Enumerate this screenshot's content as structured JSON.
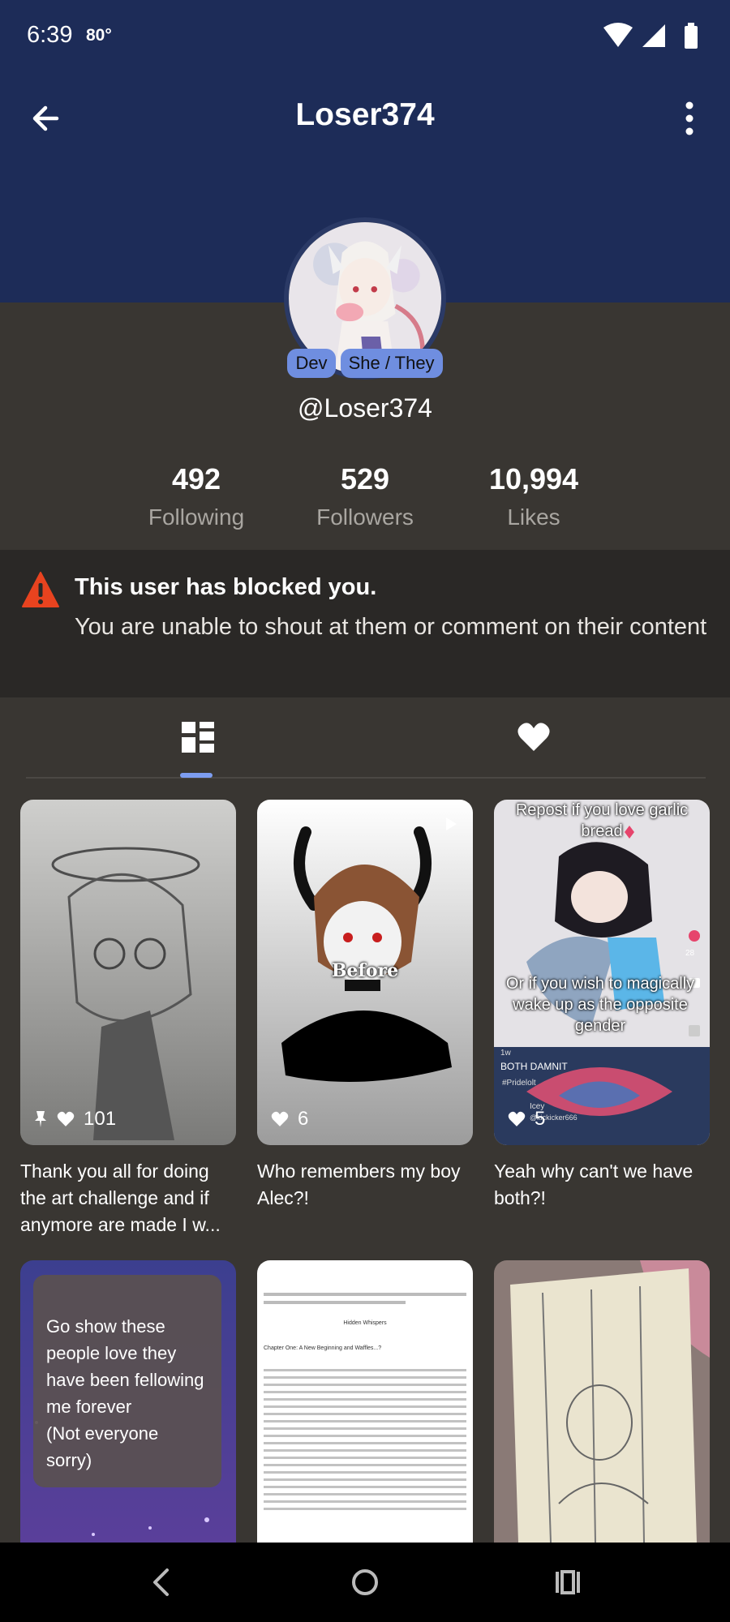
{
  "status": {
    "time": "6:39",
    "temperature": "80°"
  },
  "header": {
    "title": "Loser374"
  },
  "profile": {
    "badges": [
      "Dev",
      "She / They"
    ],
    "handle": "@Loser374",
    "stats": [
      {
        "value": "492",
        "label": "Following"
      },
      {
        "value": "529",
        "label": "Followers"
      },
      {
        "value": "10,994",
        "label": "Likes"
      }
    ]
  },
  "blocked": {
    "title": "This user has blocked you.",
    "text": "You are unable to shout at them or comment on their content"
  },
  "tabs": [
    "grid-icon",
    "heart-icon"
  ],
  "posts": [
    {
      "likes": "101",
      "pinned": true,
      "caption": "Thank you all for doing the art challenge and if anymore are made I w..."
    },
    {
      "likes": "6",
      "caption": "Who remembers my boy Alec?!",
      "overlay_text": "Before"
    },
    {
      "likes": "5",
      "caption": "Yeah why can't we have both?!",
      "overlay_top": "Repost if you love garlic bread",
      "overlay_bottom": "Or if you wish to magically wake up as the opposite gender",
      "side_count": "28",
      "inner_title": "BOTH DAMNIT",
      "inner_tag": "#Pridelolt",
      "inner_user": "Icey",
      "inner_handle": "@kickicker666",
      "inner_time": "1w"
    },
    {
      "text": "Go show these people love they have been fellowing me forever\n(Not everyone sorry)"
    },
    {
      "doc_title": "Hidden Whispers",
      "doc_chapter": "Chapter One: A New Beginning and Waffles...?"
    },
    {}
  ],
  "colors": {
    "header": "#1d2c58",
    "background": "#393632",
    "accent": "#7d9df0",
    "warning": "#e8431f"
  }
}
